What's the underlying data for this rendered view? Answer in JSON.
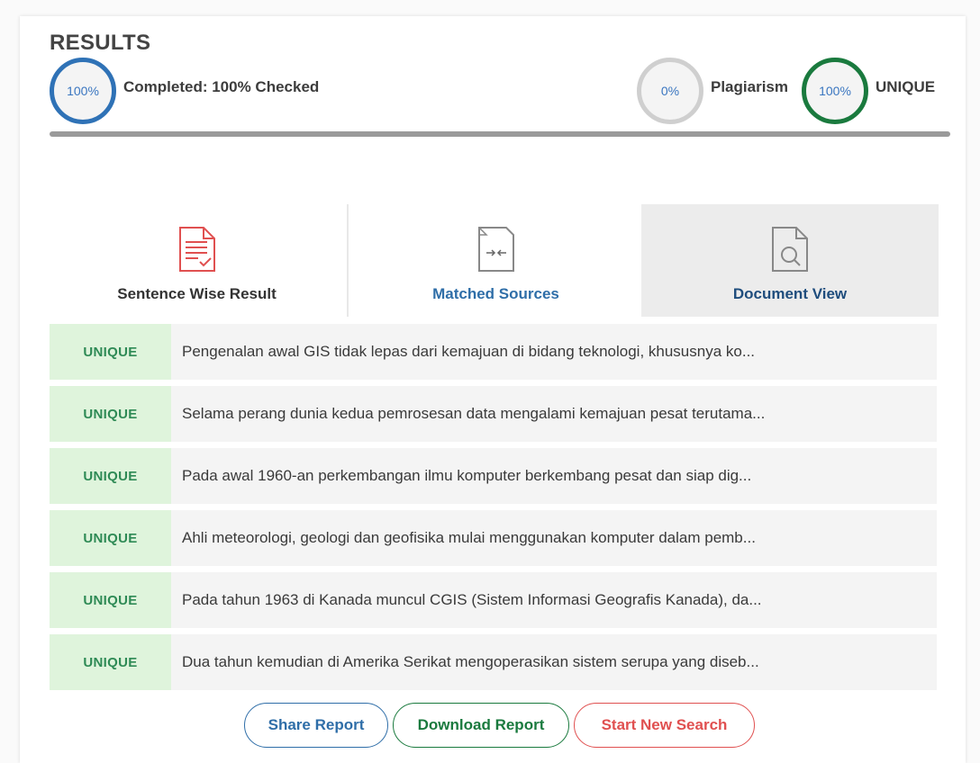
{
  "header": {
    "title": "RESULTS",
    "progress_value": "100%",
    "progress_fraction": 1.0,
    "completed_label": "Completed: 100% Checked",
    "plagiarism_value": "0%",
    "plagiarism_label": "Plagiarism",
    "unique_value": "100%",
    "unique_label": "UNIQUE"
  },
  "tabs": [
    {
      "label": "Sentence Wise Result",
      "icon": "report-document-icon"
    },
    {
      "label": "Matched Sources",
      "icon": "compare-document-icon"
    },
    {
      "label": "Document View",
      "icon": "document-search-icon"
    }
  ],
  "results": [
    {
      "status": "UNIQUE",
      "text": "Pengenalan awal GIS tidak lepas dari kemajuan di bidang teknologi, khususnya ko..."
    },
    {
      "status": "UNIQUE",
      "text": "Selama perang dunia kedua pemrosesan data mengalami kemajuan pesat terutama..."
    },
    {
      "status": "UNIQUE",
      "text": "Pada awal 1960-an perkembangan ilmu komputer berkembang pesat dan siap dig..."
    },
    {
      "status": "UNIQUE",
      "text": "Ahli meteorologi, geologi dan geofisika mulai menggunakan komputer dalam pemb..."
    },
    {
      "status": "UNIQUE",
      "text": "Pada tahun 1963 di Kanada muncul CGIS (Sistem Informasi Geografis Kanada), da..."
    },
    {
      "status": "UNIQUE",
      "text": "Dua tahun kemudian di Amerika Serikat mengoperasikan sistem serupa yang diseb..."
    }
  ],
  "actions": {
    "share": "Share Report",
    "download": "Download Report",
    "new_search": "Start New Search"
  },
  "colors": {
    "progress_ring": "#2f72b6",
    "plagiarism_ring": "#cfcfcf",
    "unique_ring": "#1a7a3e",
    "unique_badge_bg": "#dff4dc",
    "unique_badge_text": "#2e8a55",
    "danger": "#e05050"
  }
}
